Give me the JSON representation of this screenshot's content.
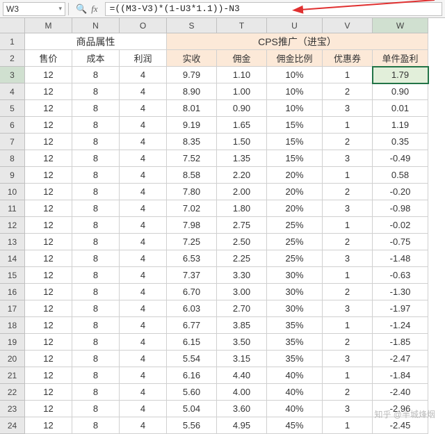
{
  "name_box": "W3",
  "formula": "=((M3-V3)*(1-U3*1.1))-N3",
  "columns": [
    "M",
    "N",
    "O",
    "S",
    "T",
    "U",
    "V",
    "W"
  ],
  "group_headers": {
    "left": "商品属性",
    "right": "CPS推广（进宝）"
  },
  "sub_headers": {
    "M": "售价",
    "N": "成本",
    "O": "利润",
    "S": "实收",
    "T": "佣金",
    "U": "佣金比例",
    "V": "优惠券",
    "W": "单件盈利"
  },
  "rows": [
    {
      "n": 3,
      "M": "12",
      "N": "8",
      "O": "4",
      "S": "9.79",
      "T": "1.10",
      "U": "10%",
      "V": "1",
      "W": "1.79"
    },
    {
      "n": 4,
      "M": "12",
      "N": "8",
      "O": "4",
      "S": "8.90",
      "T": "1.00",
      "U": "10%",
      "V": "2",
      "W": "0.90"
    },
    {
      "n": 5,
      "M": "12",
      "N": "8",
      "O": "4",
      "S": "8.01",
      "T": "0.90",
      "U": "10%",
      "V": "3",
      "W": "0.01"
    },
    {
      "n": 6,
      "M": "12",
      "N": "8",
      "O": "4",
      "S": "9.19",
      "T": "1.65",
      "U": "15%",
      "V": "1",
      "W": "1.19"
    },
    {
      "n": 7,
      "M": "12",
      "N": "8",
      "O": "4",
      "S": "8.35",
      "T": "1.50",
      "U": "15%",
      "V": "2",
      "W": "0.35"
    },
    {
      "n": 8,
      "M": "12",
      "N": "8",
      "O": "4",
      "S": "7.52",
      "T": "1.35",
      "U": "15%",
      "V": "3",
      "W": "-0.49"
    },
    {
      "n": 9,
      "M": "12",
      "N": "8",
      "O": "4",
      "S": "8.58",
      "T": "2.20",
      "U": "20%",
      "V": "1",
      "W": "0.58"
    },
    {
      "n": 10,
      "M": "12",
      "N": "8",
      "O": "4",
      "S": "7.80",
      "T": "2.00",
      "U": "20%",
      "V": "2",
      "W": "-0.20"
    },
    {
      "n": 11,
      "M": "12",
      "N": "8",
      "O": "4",
      "S": "7.02",
      "T": "1.80",
      "U": "20%",
      "V": "3",
      "W": "-0.98"
    },
    {
      "n": 12,
      "M": "12",
      "N": "8",
      "O": "4",
      "S": "7.98",
      "T": "2.75",
      "U": "25%",
      "V": "1",
      "W": "-0.02"
    },
    {
      "n": 13,
      "M": "12",
      "N": "8",
      "O": "4",
      "S": "7.25",
      "T": "2.50",
      "U": "25%",
      "V": "2",
      "W": "-0.75"
    },
    {
      "n": 14,
      "M": "12",
      "N": "8",
      "O": "4",
      "S": "6.53",
      "T": "2.25",
      "U": "25%",
      "V": "3",
      "W": "-1.48"
    },
    {
      "n": 15,
      "M": "12",
      "N": "8",
      "O": "4",
      "S": "7.37",
      "T": "3.30",
      "U": "30%",
      "V": "1",
      "W": "-0.63"
    },
    {
      "n": 16,
      "M": "12",
      "N": "8",
      "O": "4",
      "S": "6.70",
      "T": "3.00",
      "U": "30%",
      "V": "2",
      "W": "-1.30"
    },
    {
      "n": 17,
      "M": "12",
      "N": "8",
      "O": "4",
      "S": "6.03",
      "T": "2.70",
      "U": "30%",
      "V": "3",
      "W": "-1.97"
    },
    {
      "n": 18,
      "M": "12",
      "N": "8",
      "O": "4",
      "S": "6.77",
      "T": "3.85",
      "U": "35%",
      "V": "1",
      "W": "-1.24"
    },
    {
      "n": 19,
      "M": "12",
      "N": "8",
      "O": "4",
      "S": "6.15",
      "T": "3.50",
      "U": "35%",
      "V": "2",
      "W": "-1.85"
    },
    {
      "n": 20,
      "M": "12",
      "N": "8",
      "O": "4",
      "S": "5.54",
      "T": "3.15",
      "U": "35%",
      "V": "3",
      "W": "-2.47"
    },
    {
      "n": 21,
      "M": "12",
      "N": "8",
      "O": "4",
      "S": "6.16",
      "T": "4.40",
      "U": "40%",
      "V": "1",
      "W": "-1.84"
    },
    {
      "n": 22,
      "M": "12",
      "N": "8",
      "O": "4",
      "S": "5.60",
      "T": "4.00",
      "U": "40%",
      "V": "2",
      "W": "-2.40"
    },
    {
      "n": 23,
      "M": "12",
      "N": "8",
      "O": "4",
      "S": "5.04",
      "T": "3.60",
      "U": "40%",
      "V": "3",
      "W": "-2.96"
    },
    {
      "n": 24,
      "M": "12",
      "N": "8",
      "O": "4",
      "S": "5.56",
      "T": "4.95",
      "U": "45%",
      "V": "1",
      "W": "-2.45"
    }
  ],
  "active_cell": "W3",
  "watermark": "知乎 @半城烽烟"
}
